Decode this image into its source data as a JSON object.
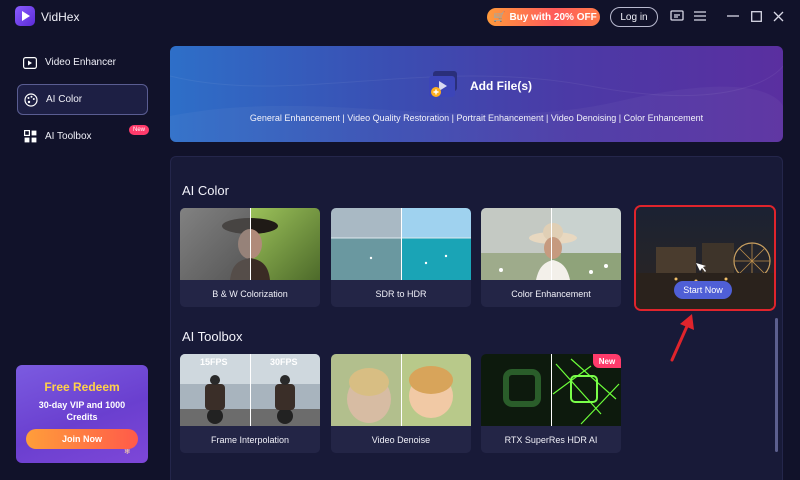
{
  "app": {
    "name": "VidHex"
  },
  "titlebar": {
    "buy_label": "Buy with 20% OFF",
    "login_label": "Log in",
    "icons": [
      "feedback-icon",
      "menu-icon",
      "minimize-icon",
      "maximize-icon",
      "close-icon"
    ]
  },
  "sidebar": {
    "items": [
      {
        "label": "Video Enhancer",
        "icon": "video-enhancer-icon"
      },
      {
        "label": "AI Color",
        "icon": "palette-icon",
        "active": true
      },
      {
        "label": "AI Toolbox",
        "icon": "toolbox-icon",
        "badge": "New"
      }
    ],
    "redeem": {
      "title": "Free Redeem",
      "description": "30-day VIP and 1000 Credits",
      "button": "Join Now"
    }
  },
  "banner": {
    "title": "Add File(s)",
    "subtitle": "General Enhancement | Video Quality Restoration | Portrait Enhancement | Video Denoising | Color Enhancement"
  },
  "sections": {
    "ai_color": {
      "title": "AI Color",
      "cards": [
        {
          "label": "B & W Colorization"
        },
        {
          "label": "SDR to HDR"
        },
        {
          "label": "Color Enhancement"
        },
        {
          "label": "",
          "hover_button": "Start Now"
        }
      ]
    },
    "ai_toolbox": {
      "title": "AI Toolbox",
      "cards": [
        {
          "label": "Frame Interpolation",
          "overlay_left": "15FPS",
          "overlay_right": "30FPS"
        },
        {
          "label": "Video Denoise"
        },
        {
          "label": "RTX SuperRes HDR AI",
          "badge": "New"
        }
      ]
    }
  },
  "colors": {
    "background": "#11122a",
    "accent": "#4f5fd6",
    "highlight_border": "#e0242c",
    "new_badge": "#ff3b6b"
  }
}
